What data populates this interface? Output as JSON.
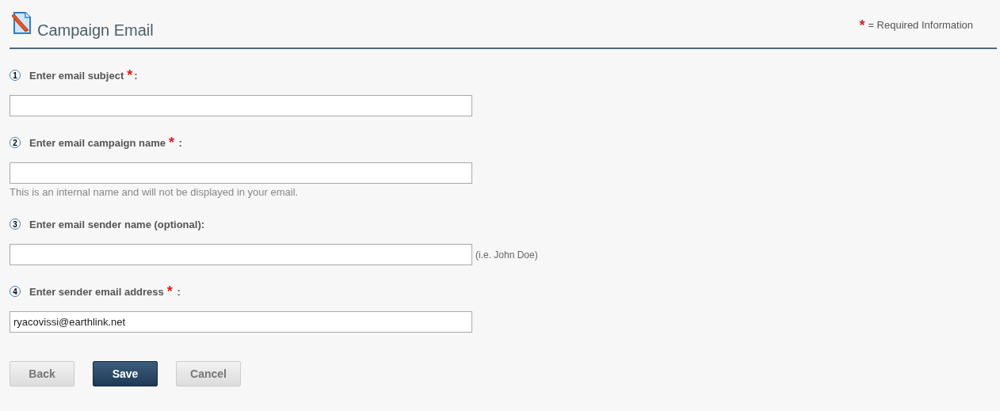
{
  "header": {
    "title": "Campaign Email",
    "legend": {
      "mark": "*",
      "text": "= Required Information"
    }
  },
  "fields": [
    {
      "number": "1",
      "label": "Enter email subject",
      "required_mark": "*",
      "suffix": ":"
    },
    {
      "number": "2",
      "label": "Enter email campaign name",
      "required_mark": "*",
      "suffix": " :",
      "note": "This is an internal name and will not be displayed in your email."
    },
    {
      "number": "3",
      "label": "Enter email sender name (optional):",
      "side_hint": "(i.e. John Doe)"
    },
    {
      "number": "4",
      "label": "Enter sender email address",
      "required_mark": "*",
      "suffix": " :",
      "value": "ryacovissi@earthlink.net"
    }
  ],
  "buttons": [
    {
      "label": "Back",
      "kind": "secondary"
    },
    {
      "label": "Save",
      "kind": "primary"
    },
    {
      "label": "Cancel",
      "kind": "secondary"
    }
  ]
}
